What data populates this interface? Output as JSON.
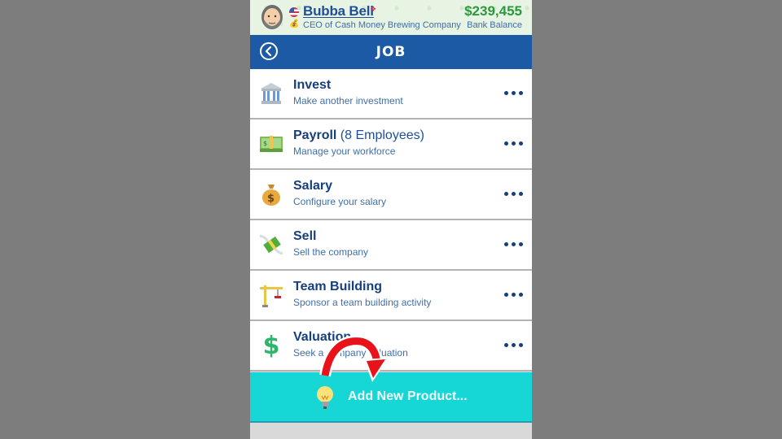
{
  "header": {
    "player_name": "Bubba Bell",
    "job_title": "CEO of Cash Money Brewing Company",
    "balance": "$239,455",
    "balance_label": "Bank Balance",
    "icons": {
      "avatar": "bearded-man-avatar",
      "flag": "us-flag-icon",
      "badge": "ribbon-badge-icon",
      "title": "money-bag-icon"
    }
  },
  "nav": {
    "title": "JOB",
    "back_icon": "chevron-left-circle-icon"
  },
  "items": [
    {
      "title": "Invest",
      "extra": "",
      "subtitle": "Make another investment",
      "icon": "bank-icon"
    },
    {
      "title": "Payroll",
      "extra": " (8 Employees)",
      "subtitle": "Manage your workforce",
      "icon": "banknote-icon"
    },
    {
      "title": "Salary",
      "extra": "",
      "subtitle": "Configure your salary",
      "icon": "money-bag-icon"
    },
    {
      "title": "Sell",
      "extra": "",
      "subtitle": "Sell the company",
      "icon": "money-with-wings-icon"
    },
    {
      "title": "Team Building",
      "extra": "",
      "subtitle": "Sponsor a team building activity",
      "icon": "crane-icon"
    },
    {
      "title": "Valuation",
      "extra": "",
      "subtitle": "Seek a company valuation",
      "icon": "dollar-sign-icon"
    }
  ],
  "add_product": {
    "label": "Add New Product...",
    "icon": "light-bulb-icon"
  },
  "annotation": {
    "icon": "red-curved-arrow-icon",
    "color": "#e8121a"
  },
  "colors": {
    "nav": "#1d5aa6",
    "accent": "#17d6d6",
    "balance": "#2c9a3c",
    "title_text": "#163f7e"
  }
}
